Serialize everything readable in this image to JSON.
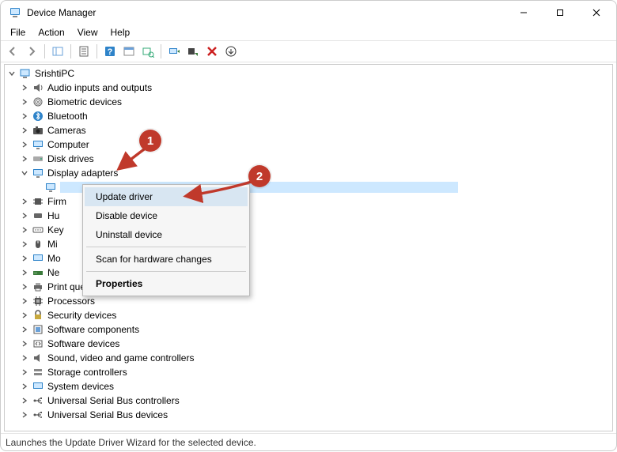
{
  "window": {
    "title": "Device Manager"
  },
  "menubar": {
    "items": [
      "File",
      "Action",
      "View",
      "Help"
    ]
  },
  "tree": {
    "root": "SrishtiPC",
    "categories": [
      "Audio inputs and outputs",
      "Biometric devices",
      "Bluetooth",
      "Cameras",
      "Computer",
      "Disk drives",
      "Display adapters",
      "Firm",
      "Hu",
      "Key",
      "Mi",
      "Mo",
      "Ne",
      "Print queues",
      "Processors",
      "Security devices",
      "Software components",
      "Software devices",
      "Sound, video and game controllers",
      "Storage controllers",
      "System devices",
      "Universal Serial Bus controllers",
      "Universal Serial Bus devices"
    ],
    "expanded_index": 6
  },
  "context_menu": {
    "items": [
      "Update driver",
      "Disable device",
      "Uninstall device",
      "Scan for hardware changes",
      "Properties"
    ],
    "hover_index": 0,
    "bold_index": 4
  },
  "statusbar": {
    "text": "Launches the Update Driver Wizard for the selected device."
  },
  "callouts": {
    "badge1": "1",
    "badge2": "2"
  }
}
